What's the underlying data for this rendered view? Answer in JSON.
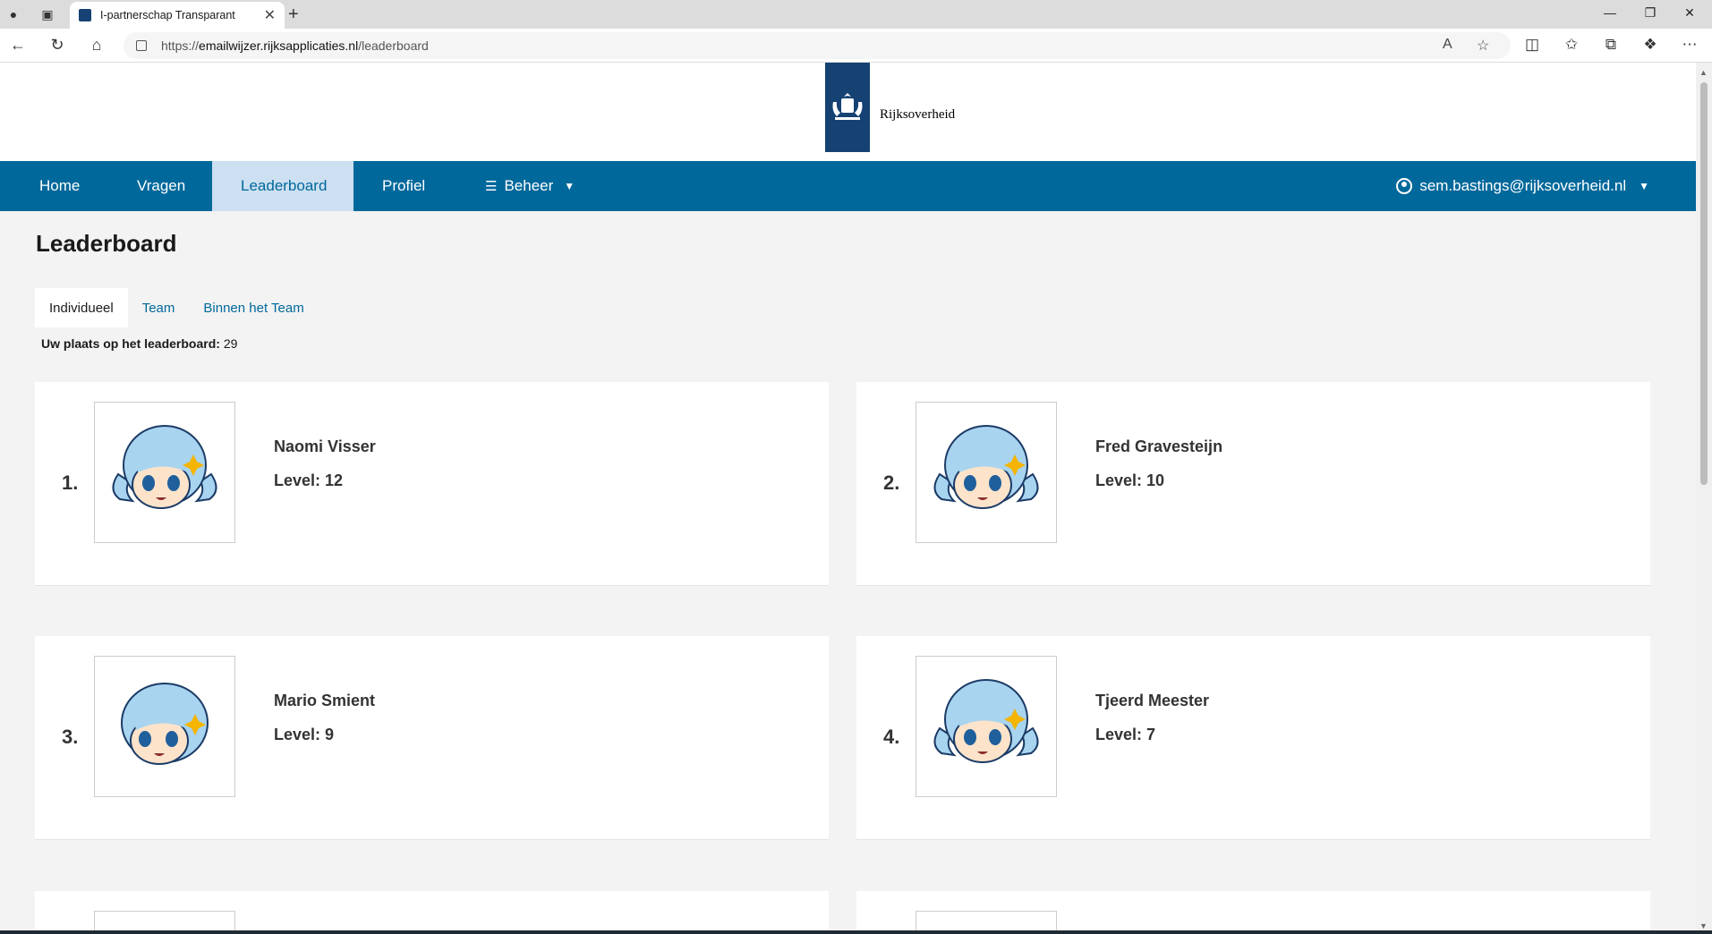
{
  "browser": {
    "tab_title": "I-partnerschap Transparant",
    "url_prefix": "https://",
    "url_host": "emailwijzer.rijksapplicaties.nl",
    "url_path": "/leaderboard"
  },
  "header": {
    "logo_text": "Rijksoverheid"
  },
  "nav": {
    "items": [
      {
        "label": "Home"
      },
      {
        "label": "Vragen"
      },
      {
        "label": "Leaderboard"
      },
      {
        "label": "Profiel"
      },
      {
        "label": "Beheer"
      }
    ],
    "user": "sem.bastings@rijksoverheid.nl"
  },
  "page": {
    "title": "Leaderboard",
    "tabs": [
      "Individueel",
      "Team",
      "Binnen het Team"
    ],
    "my_place_label": "Uw plaats op het leaderboard:",
    "my_place_value": "29"
  },
  "leaderboard": [
    {
      "rank": "1.",
      "name": "Naomi Visser",
      "level": "Level: 12",
      "avatar": "anime-girl-pigtails-avatar"
    },
    {
      "rank": "2.",
      "name": "Fred Gravesteijn",
      "level": "Level: 10",
      "avatar": "anime-girl-pigtails-avatar"
    },
    {
      "rank": "3.",
      "name": "Mario Smient",
      "level": "Level: 9",
      "avatar": "anime-girl-short-hair-avatar"
    },
    {
      "rank": "4.",
      "name": "Tjeerd Meester",
      "level": "Level: 7",
      "avatar": "anime-girl-pigtails-avatar"
    }
  ],
  "colors": {
    "brand_blue": "#01689b",
    "logo_blue": "#154273",
    "active_nav": "#cce0f1"
  }
}
